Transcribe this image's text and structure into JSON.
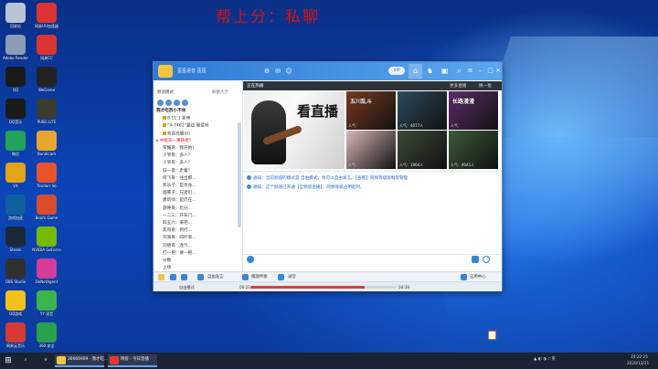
{
  "banner": "帮上分：私聊",
  "desktop_icons": [
    {
      "label": "回收站",
      "color": "#b7c4d4"
    },
    {
      "label": "Adobe Reader",
      "color": "#8a9db4"
    },
    {
      "label": "QQ",
      "color": "#1a1a1a"
    },
    {
      "label": "QQ音乐",
      "color": "#1a1a1a"
    },
    {
      "label": "微信",
      "color": "#21a35a"
    },
    {
      "label": "VX",
      "color": "#e1a319"
    },
    {
      "label": "游戏加速",
      "color": "#0e5f9e"
    },
    {
      "label": "Steam",
      "color": "#1b2838"
    },
    {
      "label": "OBS Studio",
      "color": "#303030"
    },
    {
      "label": "QQ游戏",
      "color": "#f2c21b"
    },
    {
      "label": "网易云音乐",
      "color": "#d43c33"
    },
    {
      "label": "网易UU加速器",
      "color": "#d33"
    },
    {
      "label": "网易CC",
      "color": "#d33"
    },
    {
      "label": "WeGame",
      "color": "#222"
    },
    {
      "label": "PUBG LITE",
      "color": "#3b3b2e"
    },
    {
      "label": "Bandicam",
      "color": "#e8a530"
    },
    {
      "label": "Tenderr Vo",
      "color": "#e8532d"
    },
    {
      "label": "Boom Game",
      "color": "#d74d2b"
    },
    {
      "label": "NVIDIA GeForce",
      "color": "#76b900"
    },
    {
      "label": "DxNetAgent",
      "color": "#d53c9a"
    },
    {
      "label": "YY 语音",
      "color": "#3bb44a"
    },
    {
      "label": "360 安全",
      "color": "#27a24b"
    }
  ],
  "app": {
    "title": "歪歪语音 歪歪",
    "vip_label": "VIP",
    "left_header": "频道模式",
    "left_header2": "解散大厅",
    "channels": [
      {
        "text": "我才吃西小不休",
        "cls": "root"
      },
      {
        "text": "8 11:1 新帝",
        "cls": "sub badge"
      },
      {
        "text": "“4-7462”路边 我爱听",
        "cls": "sub badge"
      },
      {
        "text": "欢迎光临(0)",
        "cls": "sub badge"
      },
      {
        "text": "▸ 中枢岛—重铸者?",
        "cls": "red"
      },
      {
        "text": "荣耀哥：我开始?",
        "cls": "sub"
      },
      {
        "text": "少爷哥：多人？",
        "cls": "sub"
      },
      {
        "text": "少爷哥：多人？",
        "cls": "sub"
      },
      {
        "text": "旧一哥：走着?",
        "cls": "sub"
      },
      {
        "text": "阿飞哥：往出那...",
        "cls": "sub"
      },
      {
        "text": "凯乐子：是亲身...",
        "cls": "sub"
      },
      {
        "text": "烟熏子：兄弟们...",
        "cls": "sub"
      },
      {
        "text": "建筑师：是仍在...",
        "cls": "sub"
      },
      {
        "text": "游神哥：比分...",
        "cls": "sub"
      },
      {
        "text": "一二三：开车门...",
        "cls": "sub"
      },
      {
        "text": "四五六：来吧...",
        "cls": "sub"
      },
      {
        "text": "友哥哥：到打...",
        "cls": "sub"
      },
      {
        "text": "刘海哥：四叶草...",
        "cls": "sub"
      },
      {
        "text": "刘德哥：连气...",
        "cls": "sub"
      },
      {
        "text": "打一把：要一把...",
        "cls": "sub"
      },
      {
        "text": "分数",
        "cls": "sub"
      },
      {
        "text": "上场",
        "cls": "sub"
      }
    ],
    "stream_header": "正在热播",
    "stream_more": "更多直播",
    "stream_refresh": "换一批",
    "big_thumb_text": "看直播",
    "thumbs": [
      {
        "title": "五川乱斗",
        "caption": "人气：",
        "bg": "#7a3a20"
      },
      {
        "title": "",
        "caption": "人气：4077人",
        "bg": "#2c4a5e"
      },
      {
        "title": "长路漫漫",
        "caption": "人气：",
        "bg": "#5e2b6a"
      },
      {
        "title": "",
        "caption": "人气：",
        "bg": "#d9b7b7"
      },
      {
        "title": "",
        "caption": "人气：1904人",
        "bg": "#3b4a36"
      },
      {
        "title": "",
        "caption": "人气：4041人",
        "bg": "#3d5a3a"
      }
    ],
    "chat": [
      "通知：当前频道的模式是 自由模式，你可以自由发言。【查看】同频等级限制等管理",
      "通知：这个频道已开通【全频道直播】，同频等级占用起时。"
    ],
    "bottom": {
      "music": "播放伴奏",
      "record": "录音",
      "app_center": "应用中心",
      "free_talk": "自由发言"
    },
    "status": {
      "left": "自由模式",
      "time_start": "00:21",
      "time_end": "04:39",
      "progress": 0.78
    }
  },
  "taskbar": {
    "items": [
      {
        "label": "28666909 - 我才吃...",
        "color": "#f4c542"
      },
      {
        "label": "映客 - 今日直播",
        "color": "#e33"
      }
    ],
    "clock_time": "14:22:25",
    "clock_date": "2020/12/21"
  }
}
